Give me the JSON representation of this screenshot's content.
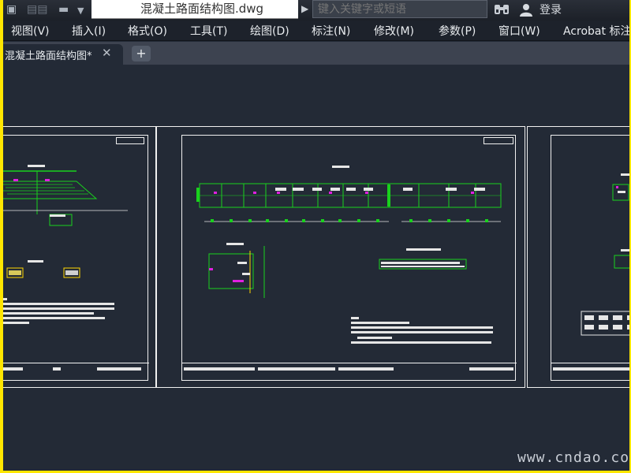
{
  "title_bar": {
    "document_title": "混凝土路面结构图.dwg",
    "search_placeholder": "键入关键字或短语",
    "login_label": "登录"
  },
  "menu": {
    "items": [
      "视图(V)",
      "插入(I)",
      "格式(O)",
      "工具(T)",
      "绘图(D)",
      "标注(N)",
      "修改(M)",
      "参数(P)",
      "窗口(W)",
      "Acrobat 标注"
    ]
  },
  "tabs": {
    "document_tab_label": "混凝土路面结构图*",
    "close_glyph": "✕",
    "new_tab_glyph": "+"
  },
  "watermark": "www.cndao.com",
  "colors": {
    "canvas_bg": "#232a36",
    "frame_border": "#ffe600",
    "drawing_lines": "#f0f0f0",
    "drawing_green": "#19d11d",
    "drawing_magenta": "#e020e0"
  },
  "icons": [
    "app-menu-icon",
    "qat-dropdown-icon",
    "search-arrow-icon",
    "binoculars-icon",
    "user-icon",
    "tab-close-icon",
    "new-tab-icon"
  ]
}
